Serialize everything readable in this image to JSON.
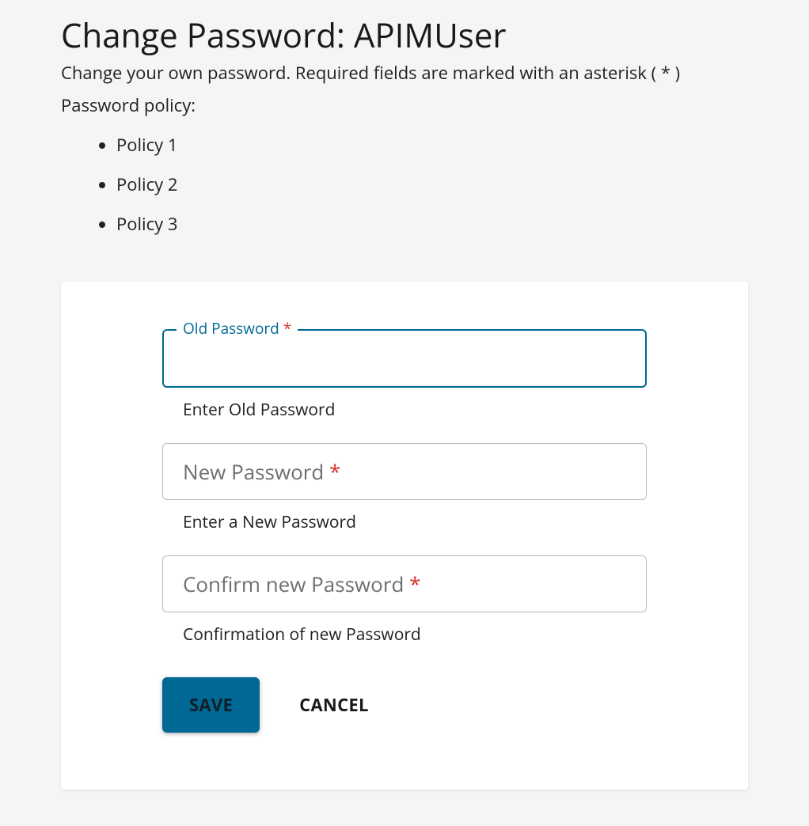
{
  "header": {
    "title": "Change Password: APIMUser",
    "subtitle": "Change your own password. Required fields are marked with an asterisk ( * )",
    "policy_heading": "Password policy:",
    "policies": [
      "Policy 1",
      "Policy 2",
      "Policy 3"
    ]
  },
  "form": {
    "old_password": {
      "label": "Old Password",
      "required_mark": "*",
      "helper": "Enter Old Password",
      "value": ""
    },
    "new_password": {
      "label": "New Password",
      "required_mark": "*",
      "helper": "Enter a New Password",
      "value": ""
    },
    "confirm_password": {
      "label": "Confirm new Password",
      "required_mark": "*",
      "helper": "Confirmation of new Password",
      "value": ""
    },
    "buttons": {
      "save": "SAVE",
      "cancel": "CANCEL"
    }
  }
}
